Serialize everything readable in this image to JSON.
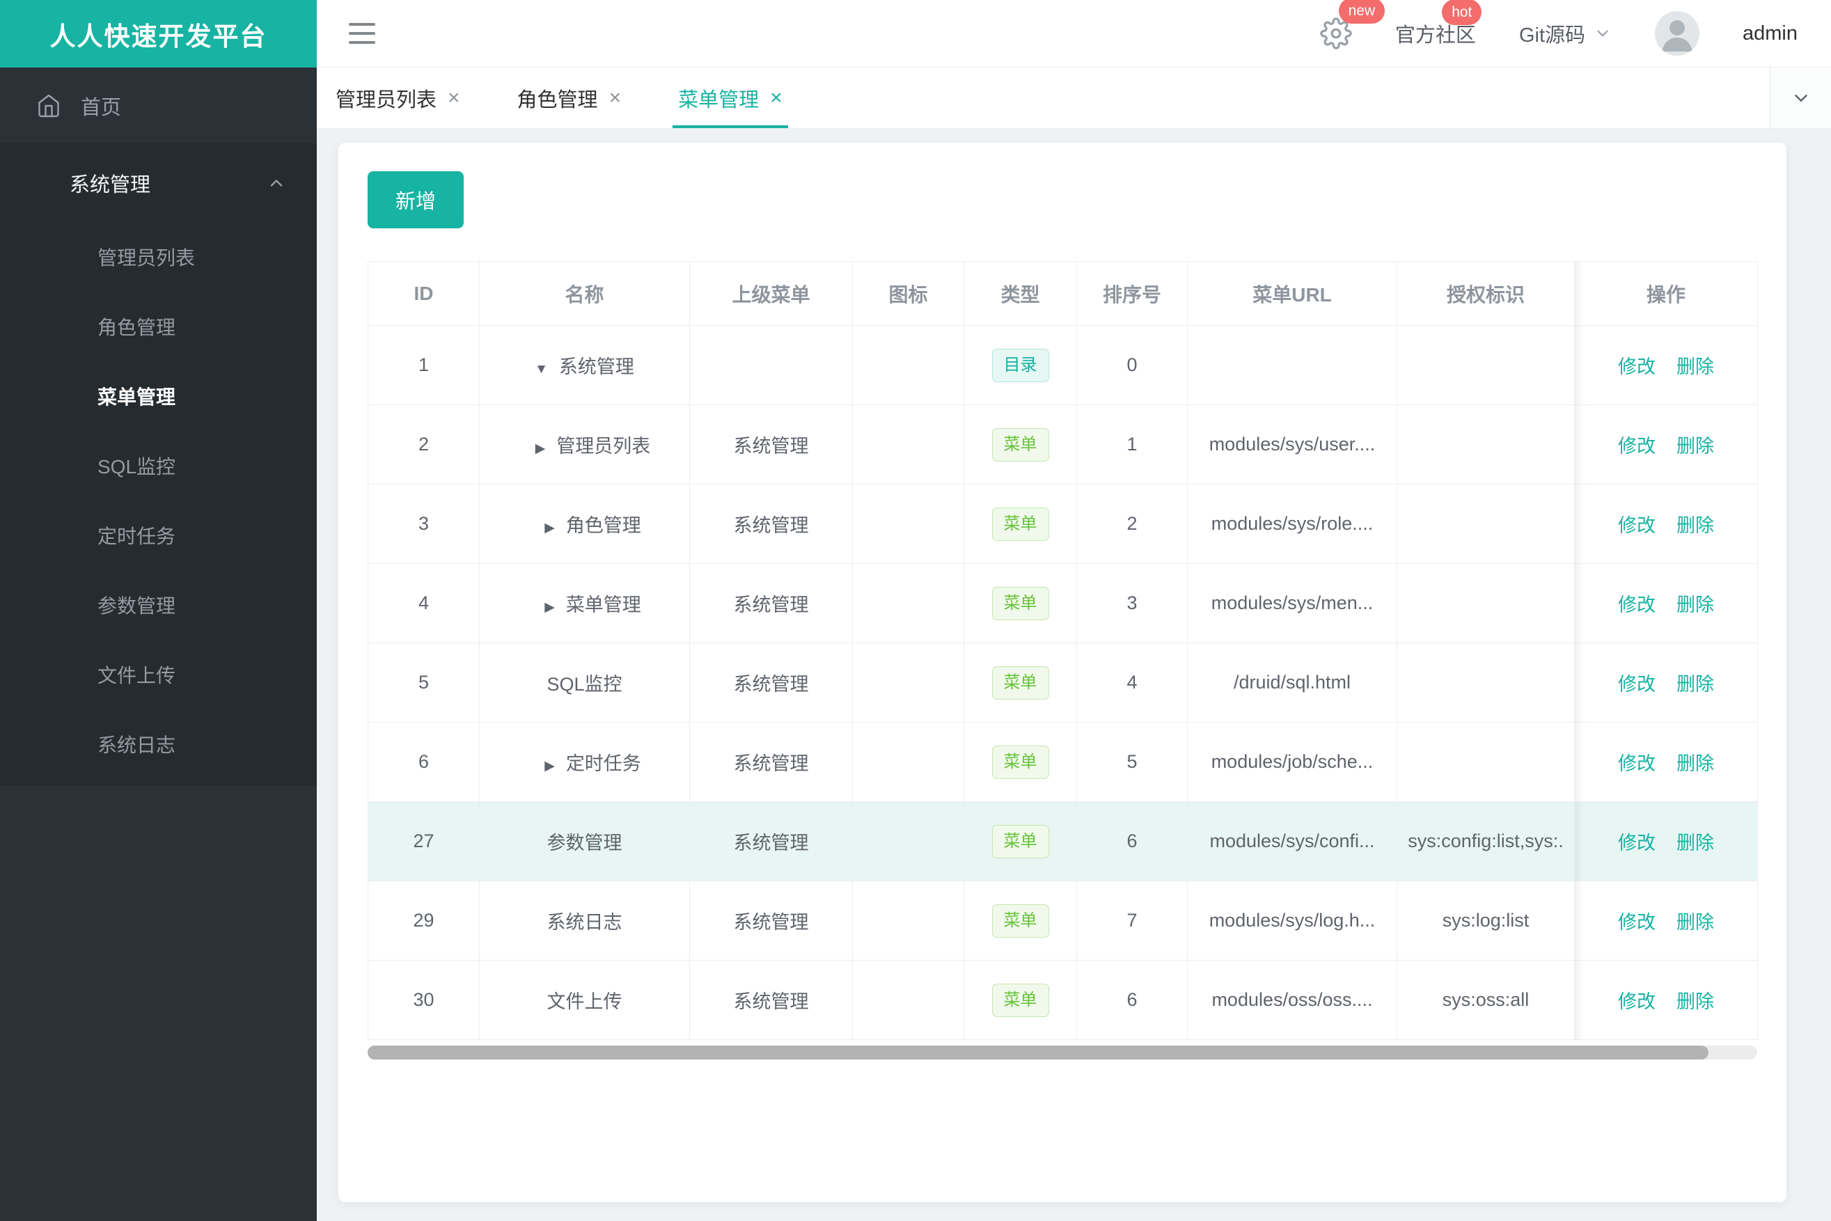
{
  "app": {
    "title": "人人快速开发平台"
  },
  "header": {
    "notice_badge": "new",
    "community_label": "官方社区",
    "community_badge": "hot",
    "git_label": "Git源码",
    "username": "admin"
  },
  "sidebar": {
    "home_label": "首页",
    "section_label": "系统管理",
    "items": [
      {
        "slug": "admin-list",
        "label": "管理员列表",
        "active": false
      },
      {
        "slug": "role",
        "label": "角色管理",
        "active": false
      },
      {
        "slug": "menu",
        "label": "菜单管理",
        "active": true
      },
      {
        "slug": "sql",
        "label": "SQL监控",
        "active": false
      },
      {
        "slug": "job",
        "label": "定时任务",
        "active": false
      },
      {
        "slug": "config",
        "label": "参数管理",
        "active": false
      },
      {
        "slug": "oss",
        "label": "文件上传",
        "active": false
      },
      {
        "slug": "log",
        "label": "系统日志",
        "active": false
      }
    ]
  },
  "tabs": [
    {
      "slug": "admin-list",
      "label": "管理员列表",
      "active": false
    },
    {
      "slug": "role",
      "label": "角色管理",
      "active": false
    },
    {
      "slug": "menu",
      "label": "菜单管理",
      "active": true
    }
  ],
  "toolbar": {
    "add_label": "新增"
  },
  "table": {
    "columns": [
      "ID",
      "名称",
      "上级菜单",
      "图标",
      "类型",
      "排序号",
      "菜单URL",
      "授权标识",
      "操作"
    ],
    "actions": {
      "edit_label": "修改",
      "delete_label": "删除"
    },
    "rows": [
      {
        "id": "1",
        "expand": "down",
        "name": "系统管理",
        "parent": "",
        "icon": "",
        "type": "目录",
        "type_kind": "dir",
        "order": "0",
        "url": "",
        "perms": "",
        "highlight": false
      },
      {
        "id": "2",
        "expand": "right",
        "name": "管理员列表",
        "parent": "系统管理",
        "icon": "",
        "type": "菜单",
        "type_kind": "menu",
        "order": "1",
        "url": "modules/sys/user....",
        "perms": "",
        "highlight": false
      },
      {
        "id": "3",
        "expand": "right",
        "name": "角色管理",
        "parent": "系统管理",
        "icon": "",
        "type": "菜单",
        "type_kind": "menu",
        "order": "2",
        "url": "modules/sys/role....",
        "perms": "",
        "highlight": false
      },
      {
        "id": "4",
        "expand": "right",
        "name": "菜单管理",
        "parent": "系统管理",
        "icon": "",
        "type": "菜单",
        "type_kind": "menu",
        "order": "3",
        "url": "modules/sys/men...",
        "perms": "",
        "highlight": false
      },
      {
        "id": "5",
        "expand": "none",
        "name": "SQL监控",
        "parent": "系统管理",
        "icon": "",
        "type": "菜单",
        "type_kind": "menu",
        "order": "4",
        "url": "/druid/sql.html",
        "perms": "",
        "highlight": false
      },
      {
        "id": "6",
        "expand": "right",
        "name": "定时任务",
        "parent": "系统管理",
        "icon": "",
        "type": "菜单",
        "type_kind": "menu",
        "order": "5",
        "url": "modules/job/sche...",
        "perms": "",
        "highlight": false
      },
      {
        "id": "27",
        "expand": "none",
        "name": "参数管理",
        "parent": "系统管理",
        "icon": "",
        "type": "菜单",
        "type_kind": "menu",
        "order": "6",
        "url": "modules/sys/confi...",
        "perms": "sys:config:list,sys:.",
        "highlight": true
      },
      {
        "id": "29",
        "expand": "none",
        "name": "系统日志",
        "parent": "系统管理",
        "icon": "",
        "type": "菜单",
        "type_kind": "menu",
        "order": "7",
        "url": "modules/sys/log.h...",
        "perms": "sys:log:list",
        "highlight": false
      },
      {
        "id": "30",
        "expand": "none",
        "name": "文件上传",
        "parent": "系统管理",
        "icon": "",
        "type": "菜单",
        "type_kind": "menu",
        "order": "6",
        "url": "modules/oss/oss....",
        "perms": "sys:oss:all",
        "highlight": false
      }
    ]
  },
  "colors": {
    "primary": "#17b3a3",
    "badge_red": "#f56c6c",
    "tag_dir": "#14b0a0",
    "tag_menu": "#67c23a",
    "row_highlight": "#e7f6f3"
  }
}
